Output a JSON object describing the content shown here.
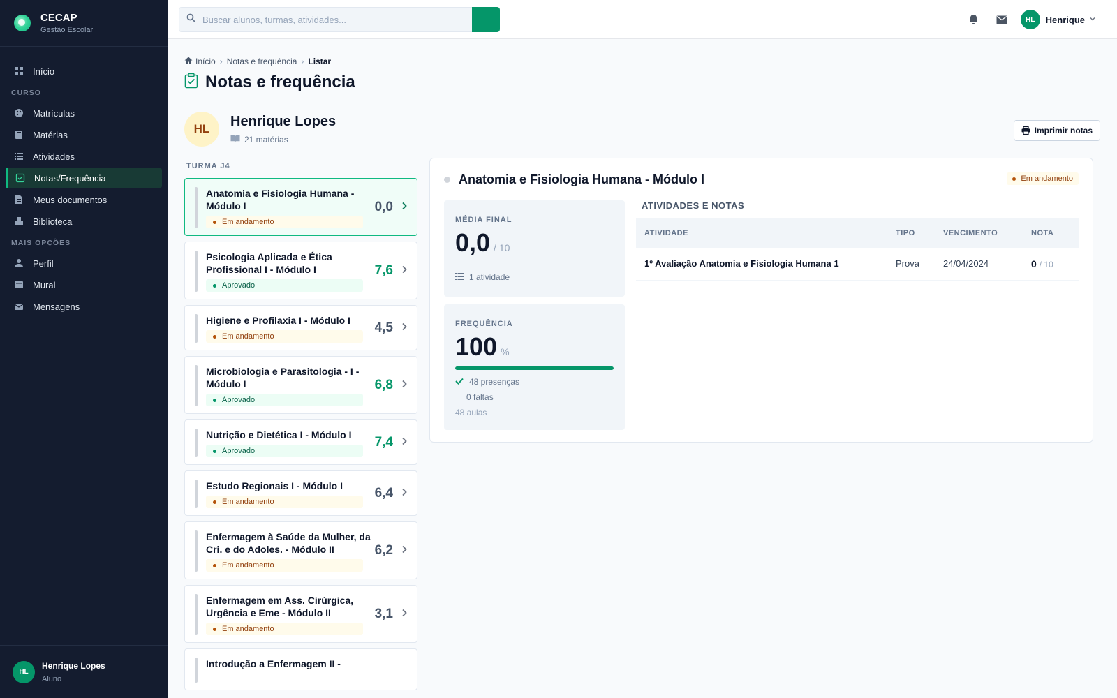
{
  "brand": {
    "name": "CECAP",
    "subtitle": "Gestão Escolar"
  },
  "nav": {
    "home": "Início",
    "section_curso": "CURSO",
    "curso_items": [
      "Matrículas",
      "Matérias",
      "Atividades",
      "Notas/Frequência",
      "Meus documentos",
      "Biblioteca"
    ],
    "section_mais": "MAIS OPÇÕES",
    "mais_items": [
      "Perfil",
      "Mural",
      "Mensagens"
    ]
  },
  "sidebar_user": {
    "initials": "HL",
    "name": "Henrique Lopes",
    "role": "Aluno"
  },
  "search": {
    "placeholder": "Buscar alunos, turmas, atividades..."
  },
  "topbar_user": {
    "initials": "HL",
    "name": "Henrique"
  },
  "breadcrumb": {
    "home": "Início",
    "section": "Notas e frequência",
    "current": "Listar"
  },
  "page_title": "Notas e frequência",
  "student": {
    "initials": "HL",
    "name": "Henrique Lopes",
    "subjects_count": "21 matérias"
  },
  "print_label": "Imprimir notas",
  "turma_label": "TURMA J4",
  "subjects": [
    {
      "name": "Anatomia e Fisiologia Humana - Módulo I",
      "status": "Em andamento",
      "grade": "0,0"
    },
    {
      "name": "Psicologia Aplicada e Ética Profissional I - Módulo I",
      "status": "Aprovado",
      "grade": "7,6"
    },
    {
      "name": "Higiene e Profilaxia I - Módulo I",
      "status": "Em andamento",
      "grade": "4,5"
    },
    {
      "name": "Microbiologia e Parasitologia - I - Módulo I",
      "status": "Aprovado",
      "grade": "6,8"
    },
    {
      "name": "Nutrição e Dietética I - Módulo I",
      "status": "Aprovado",
      "grade": "7,4"
    },
    {
      "name": "Estudo Regionais I - Módulo I",
      "status": "Em andamento",
      "grade": "6,4"
    },
    {
      "name": "Enfermagem à Saúde da Mulher, da Cri. e do Adoles. - Módulo II",
      "status": "Em andamento",
      "grade": "6,2"
    },
    {
      "name": "Enfermagem em Ass. Cirúrgica, Urgência e Eme - Módulo II",
      "status": "Em andamento",
      "grade": "3,1"
    },
    {
      "name": "Introdução a Enfermagem II -",
      "status": "",
      "grade": ""
    }
  ],
  "detail": {
    "title": "Anatomia e Fisiologia Humana - Módulo I",
    "status": "Em andamento",
    "media": {
      "label": "MÉDIA FINAL",
      "value": "0,0",
      "out_of": "/ 10",
      "activities": "1 atividade"
    },
    "freq": {
      "label": "FREQUÊNCIA",
      "value": "100",
      "unit": "%",
      "percent": 100,
      "presencas": "48 presenças",
      "faltas": "0 faltas",
      "aulas": "48 aulas"
    },
    "acts_title": "ATIVIDADES E NOTAS",
    "columns": [
      "ATIVIDADE",
      "TIPO",
      "VENCIMENTO",
      "NOTA"
    ],
    "rows": [
      {
        "atividade": "1º Avaliação Anatomia e Fisiologia Humana 1",
        "tipo": "Prova",
        "vencimento": "24/04/2024",
        "nota": "0",
        "nota_max": "/ 10"
      }
    ]
  },
  "colors": {
    "accent": "#059669",
    "sidebar": "#141c2f",
    "warning": "#92400e"
  }
}
